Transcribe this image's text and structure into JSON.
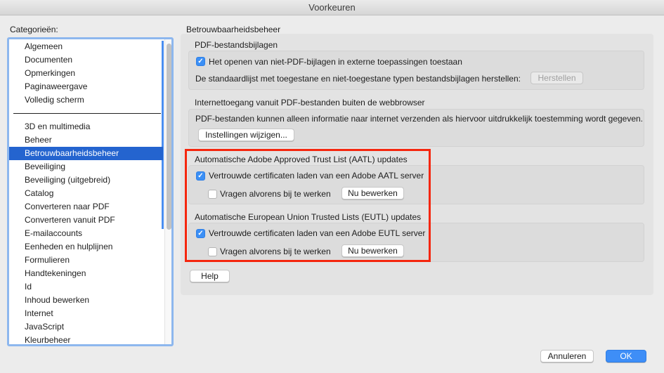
{
  "window": {
    "title": "Voorkeuren"
  },
  "sidebar": {
    "label": "Categorieën:",
    "group1": [
      "Algemeen",
      "Documenten",
      "Opmerkingen",
      "Paginaweergave",
      "Volledig scherm"
    ],
    "group2": [
      "3D en multimedia",
      "Beheer",
      "Betrouwbaarheidsbeheer",
      "Beveiliging",
      "Beveiliging (uitgebreid)",
      "Catalog",
      "Converteren naar PDF",
      "Converteren vanuit PDF",
      "E-mailaccounts",
      "Eenheden en hulplijnen",
      "Formulieren",
      "Handtekeningen",
      "Id",
      "Inhoud bewerken",
      "Internet",
      "JavaScript",
      "Kleurbeheer"
    ],
    "selected": "Betrouwbaarheidsbeheer"
  },
  "main": {
    "title": "Betrouwbaarheidsbeheer",
    "attachments": {
      "label": "PDF-bestandsbijlagen",
      "checkbox": "Het openen van niet-PDF-bijlagen in externe toepassingen toestaan",
      "checked": true,
      "reset_text": "De standaardlijst met toegestane en niet-toegestane typen bestandsbijlagen herstellen:",
      "reset_button": "Herstellen"
    },
    "internet": {
      "label": "Internettoegang vanuit PDF-bestanden buiten de webbrowser",
      "text": "PDF-bestanden kunnen alleen informatie naar internet verzenden als hiervoor uitdrukkelijk toestemming wordt gegeven.",
      "button": "Instellingen wijzigen..."
    },
    "aatl": {
      "label": "Automatische Adobe Approved Trust List (AATL) updates",
      "checkbox": "Vertrouwde certificaten laden van een Adobe AATL server",
      "checked": true,
      "ask": "Vragen alvorens bij te werken",
      "ask_checked": false,
      "button": "Nu bewerken"
    },
    "eutl": {
      "label": "Automatische European Union Trusted Lists (EUTL) updates",
      "checkbox": "Vertrouwde certificaten laden van een Adobe EUTL server",
      "checked": true,
      "ask": "Vragen alvorens bij te werken",
      "ask_checked": false,
      "button": "Nu bewerken"
    },
    "help": "Help"
  },
  "footer": {
    "cancel": "Annuleren",
    "ok": "OK"
  },
  "colors": {
    "accent": "#2464cf",
    "highlight": "#f5260e"
  }
}
